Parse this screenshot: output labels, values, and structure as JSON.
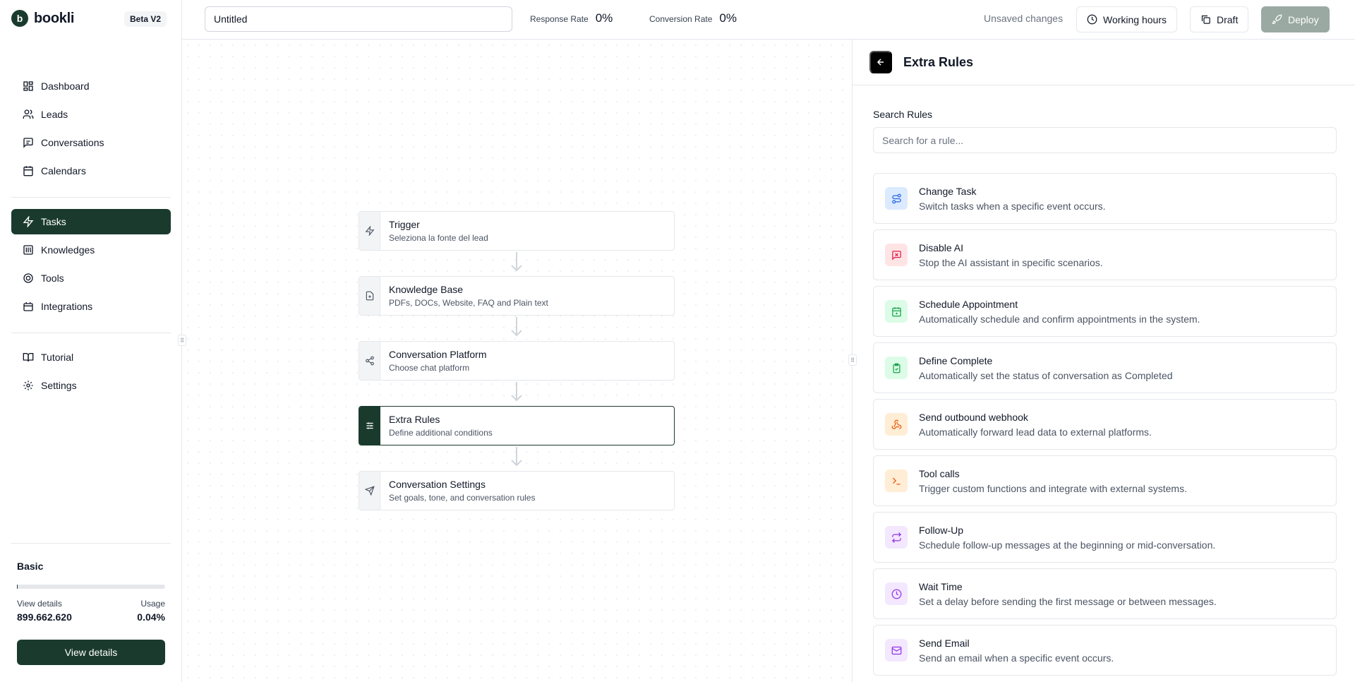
{
  "brand": {
    "logo_letter": "b",
    "name": "bookli",
    "badge": "Beta V2"
  },
  "sidebar": {
    "group1": [
      {
        "label": "Dashboard",
        "icon": "dashboard-icon"
      },
      {
        "label": "Leads",
        "icon": "users-icon"
      },
      {
        "label": "Conversations",
        "icon": "message-icon"
      },
      {
        "label": "Calendars",
        "icon": "calendar-icon"
      }
    ],
    "group2": [
      {
        "label": "Tasks",
        "icon": "zap-icon",
        "active": true
      },
      {
        "label": "Knowledges",
        "icon": "library-icon"
      },
      {
        "label": "Tools",
        "icon": "tool-icon"
      },
      {
        "label": "Integrations",
        "icon": "integrations-icon"
      }
    ],
    "group3": [
      {
        "label": "Tutorial",
        "icon": "book-icon"
      },
      {
        "label": "Settings",
        "icon": "settings-icon"
      }
    ]
  },
  "plan": {
    "name": "Basic",
    "usage_fraction": 0.0004,
    "details_label": "View details",
    "usage_label": "Usage",
    "details_value": "899.662.620",
    "usage_value": "0.04%",
    "button": "View details"
  },
  "topbar": {
    "title_value": "Untitled",
    "response_rate_label": "Response Rate",
    "response_rate_value": "0%",
    "conversion_rate_label": "Conversion Rate",
    "conversion_rate_value": "0%",
    "unsaved": "Unsaved changes",
    "working_hours": "Working hours",
    "draft": "Draft",
    "deploy": "Deploy"
  },
  "flow": {
    "nodes": [
      {
        "title": "Trigger",
        "subtitle": "Seleziona la fonte del lead",
        "icon": "zap-icon"
      },
      {
        "title": "Knowledge Base",
        "subtitle": "PDFs, DOCs, Website, FAQ and Plain text",
        "icon": "file-icon"
      },
      {
        "title": "Conversation Platform",
        "subtitle": "Choose chat platform",
        "icon": "share-icon"
      },
      {
        "title": "Extra Rules",
        "subtitle": "Define additional conditions",
        "icon": "sliders-icon",
        "active": true
      },
      {
        "title": "Conversation Settings",
        "subtitle": "Set goals, tone, and conversation rules",
        "icon": "send-icon"
      }
    ]
  },
  "panel": {
    "title": "Extra Rules",
    "search_label": "Search Rules",
    "search_placeholder": "Search for a rule...",
    "rules": [
      {
        "title": "Change Task",
        "desc": "Switch tasks when a specific event occurs.",
        "icon": "route-icon",
        "bg": "#dbeafe",
        "fg": "#2563eb"
      },
      {
        "title": "Disable AI",
        "desc": "Stop the AI assistant in specific scenarios.",
        "icon": "message-off-icon",
        "bg": "#ffe4e6",
        "fg": "#e11d48"
      },
      {
        "title": "Schedule Appointment",
        "desc": "Automatically schedule and confirm appointments in the system.",
        "icon": "calendar-plus-icon",
        "bg": "#dcfce7",
        "fg": "#16a34a"
      },
      {
        "title": "Define Complete",
        "desc": "Automatically set the status of conversation as Completed",
        "icon": "clipboard-check-icon",
        "bg": "#dcfce7",
        "fg": "#16a34a"
      },
      {
        "title": "Send outbound webhook",
        "desc": "Automatically forward lead data to external platforms.",
        "icon": "webhook-icon",
        "bg": "#ffedd5",
        "fg": "#ea580c"
      },
      {
        "title": "Tool calls",
        "desc": "Trigger custom functions and integrate with external systems.",
        "icon": "terminal-icon",
        "bg": "#ffedd5",
        "fg": "#ea580c"
      },
      {
        "title": "Follow-Up",
        "desc": "Schedule follow-up messages at the beginning or mid-conversation.",
        "icon": "repeat-icon",
        "bg": "#f3e8ff",
        "fg": "#9333ea"
      },
      {
        "title": "Wait Time",
        "desc": "Set a delay before sending the first message or between messages.",
        "icon": "clock-icon",
        "bg": "#f3e8ff",
        "fg": "#9333ea"
      },
      {
        "title": "Send Email",
        "desc": "Send an email when a specific event occurs.",
        "icon": "mail-icon",
        "bg": "#f3e8ff",
        "fg": "#9333ea"
      }
    ]
  },
  "colors": {
    "brand_dark": "#1a3a2e",
    "border": "#e5e7eb",
    "deploy_disabled": "#9aa9a2"
  }
}
